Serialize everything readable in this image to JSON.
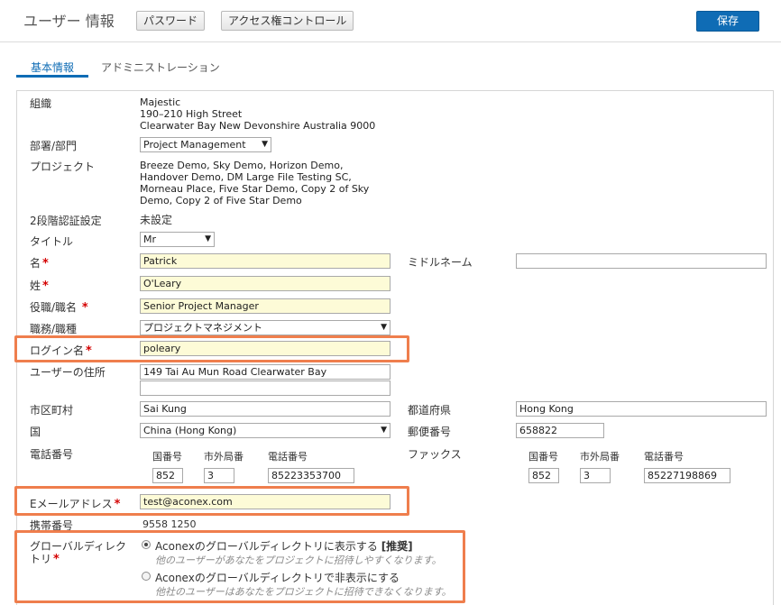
{
  "header": {
    "title": "ユーザー 情報",
    "password_button": "パスワード",
    "access_button": "アクセス権コントロール",
    "save_button": "保存"
  },
  "tabs": [
    {
      "label": "基本情報",
      "active": true
    },
    {
      "label": "アドミニストレーション",
      "active": false
    }
  ],
  "org": {
    "label": "組織",
    "lines": [
      "Majestic",
      "190–210 High Street",
      "Clearwater Bay New Devonshire Australia 9000"
    ]
  },
  "department": {
    "label": "部署/部門",
    "value": "Project Management"
  },
  "projects": {
    "label": "プロジェクト",
    "lines": [
      "Breeze Demo, Sky Demo, Horizon Demo,",
      "Handover Demo, DM Large File Testing SC,",
      "Morneau Place, Five Star Demo, Copy 2 of Sky",
      "Demo, Copy 2 of Five Star Demo"
    ]
  },
  "two_factor": {
    "label": "2段階認証設定",
    "value": "未設定"
  },
  "salutation": {
    "label": "タイトル",
    "value": "Mr"
  },
  "first_name": {
    "label": "名",
    "value": "Patrick"
  },
  "middle_name": {
    "label": "ミドルネーム",
    "value": ""
  },
  "last_name": {
    "label": "姓",
    "value": "O'Leary"
  },
  "job_title": {
    "label": "役職/職名",
    "value": "Senior Project Manager"
  },
  "job_type": {
    "label": "職務/職種",
    "value": "プロジェクトマネジメント"
  },
  "login_name": {
    "label": "ログイン名",
    "value": "poleary"
  },
  "address": {
    "label": "ユーザーの住所",
    "line1": "149 Tai Au Mun Road Clearwater Bay",
    "line2": ""
  },
  "city": {
    "label": "市区町村",
    "value": "Sai Kung"
  },
  "prefecture": {
    "label": "都道府県",
    "value": "Hong Kong"
  },
  "country": {
    "label": "国",
    "value": "China (Hong Kong)"
  },
  "postcode": {
    "label": "郵便番号",
    "value": "658822"
  },
  "phone": {
    "label": "電話番号",
    "headers": {
      "country": "国番号",
      "area": "市外局番",
      "number": "電話番号"
    },
    "country": "852",
    "area": "3",
    "number": "85223353700"
  },
  "fax": {
    "label": "ファックス",
    "headers": {
      "country": "国番号",
      "area": "市外局番",
      "number": "電話番号"
    },
    "country": "852",
    "area": "3",
    "number": "85227198869"
  },
  "email": {
    "label": "Eメールアドレス",
    "value": "test@aconex.com"
  },
  "mobile": {
    "label": "携帯番号",
    "value": "9558 1250"
  },
  "directory": {
    "label_line1": "グローバルディレク",
    "label_line2": "トリ",
    "option1": {
      "label": "Aconexのグローバルディレクトリに表示する",
      "tag": "[推奨]",
      "hint": "他のユーザーがあなたをプロジェクトに招待しやすくなります。",
      "selected": true
    },
    "option2": {
      "label": "Aconexのグローバルディレクトリで非表示にする",
      "hint": "他社のユーザーはあなたをプロジェクトに招待できなくなります。",
      "selected": false
    }
  },
  "colors": {
    "accent": "#0f6cb5",
    "highlight": "#ef7e4d",
    "required_field": "#fdfbd7",
    "required_mark": "#d40000"
  }
}
